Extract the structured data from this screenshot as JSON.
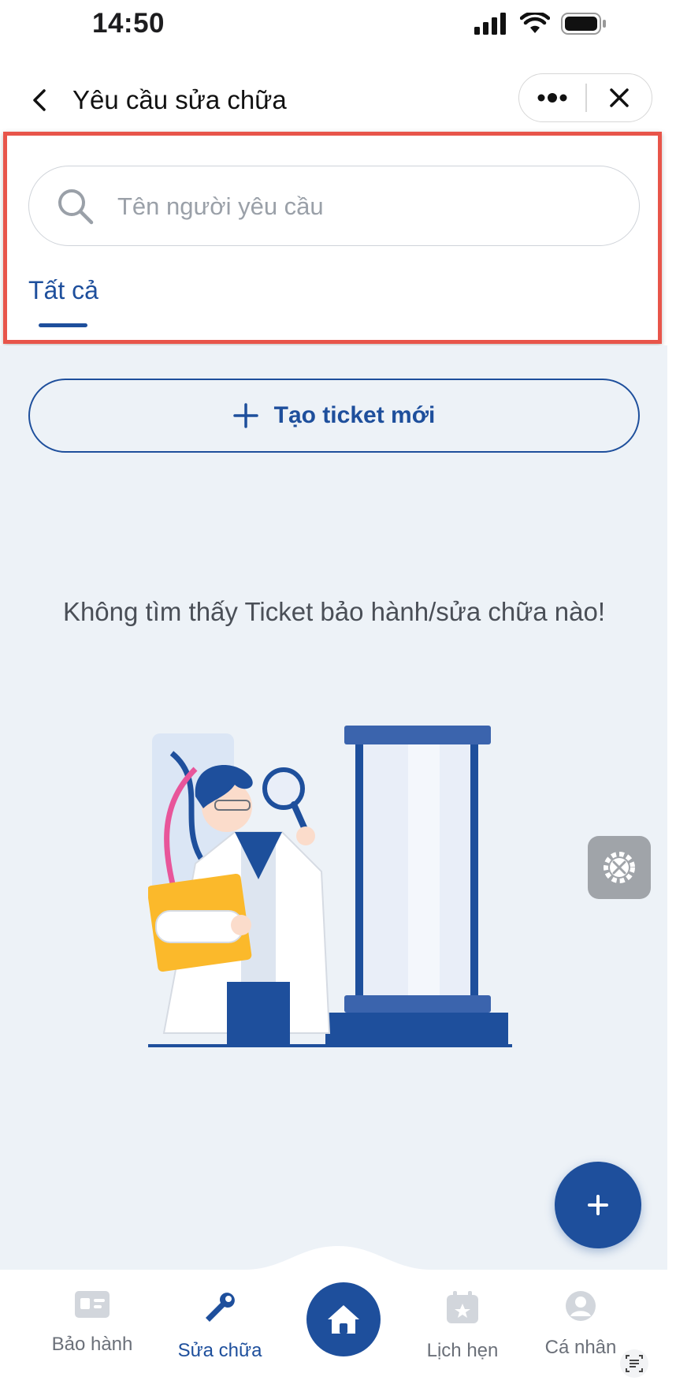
{
  "status_bar": {
    "time": "14:50"
  },
  "nav": {
    "title": "Yêu cầu sửa chữa"
  },
  "search": {
    "placeholder": "Tên người yêu cầu",
    "value": ""
  },
  "tabs": [
    {
      "label": "Tất cả",
      "active": true
    }
  ],
  "actions": {
    "create_ticket_label": "Tạo ticket mới"
  },
  "empty_state": {
    "message": "Không tìm thấy Ticket bảo hành/sửa chữa nào!"
  },
  "bottom_nav": {
    "items": [
      {
        "label": "Bảo hành",
        "icon": "id-card-icon",
        "active": false
      },
      {
        "label": "Sửa chữa",
        "icon": "wrench-icon",
        "active": true
      },
      {
        "label": "",
        "icon": "home-icon",
        "active": false
      },
      {
        "label": "Lịch hẹn",
        "icon": "calendar-star-icon",
        "active": false
      },
      {
        "label": "Cá nhân",
        "icon": "user-icon",
        "active": false
      }
    ]
  },
  "colors": {
    "primary": "#1e4f9c",
    "content_bg": "#edf2f7",
    "highlight": "#e8554a",
    "illustration_yellow": "#fbb92b",
    "illustration_pink": "#e8559a"
  }
}
